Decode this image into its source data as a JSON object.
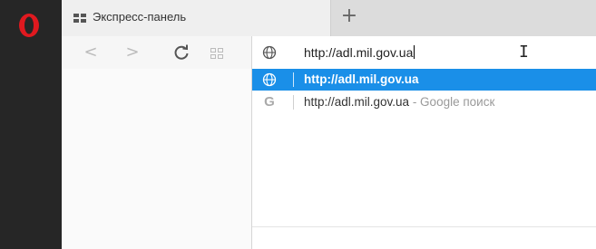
{
  "tab": {
    "title": "Экспресс-панель"
  },
  "toolbar": {
    "new_tab_label": "+",
    "back_label": "<",
    "forward_label": ">",
    "reload_label": "C"
  },
  "address_bar": {
    "value": "http://adl.mil.gov.ua"
  },
  "suggestions": [
    {
      "icon": "globe-icon",
      "text": "http://adl.mil.gov.ua",
      "hint": ""
    },
    {
      "icon": "google-g-icon",
      "text": "http://adl.mil.gov.ua",
      "hint": " - Google поиск"
    }
  ],
  "colors": {
    "sidebar": "#262626",
    "opera_red": "#e0191f",
    "highlight": "#1a8fe8"
  }
}
